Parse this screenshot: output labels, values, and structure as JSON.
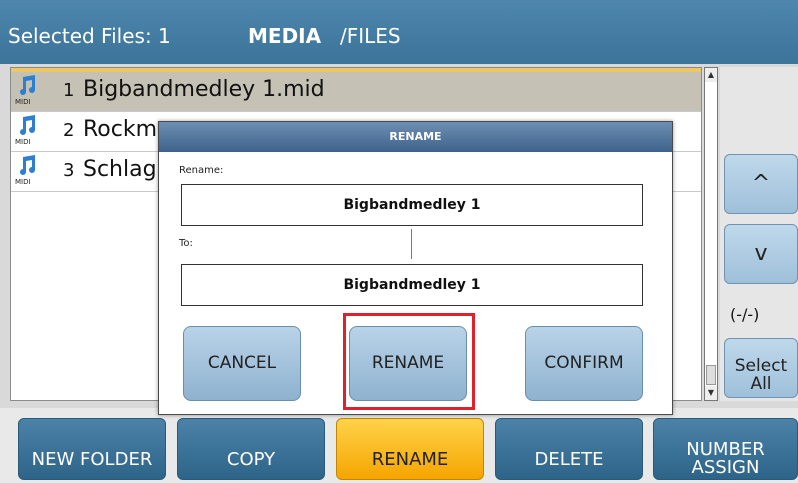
{
  "header": {
    "selected_label": "Selected Files:  1",
    "location": "MEDIA",
    "path": "/FILES"
  },
  "files": [
    {
      "num": "1",
      "name": "Bigbandmedley 1.mid",
      "type": "MIDI"
    },
    {
      "num": "2",
      "name": "Rockm",
      "type": "MIDI"
    },
    {
      "num": "3",
      "name": "Schlag",
      "type": "MIDI"
    }
  ],
  "side": {
    "up": "^",
    "down": "v",
    "page": "(-/-)",
    "select_all_1": "Select",
    "select_all_2": "All"
  },
  "dialog": {
    "title": "RENAME",
    "rename_label": "Rename:",
    "rename_value": "Bigbandmedley 1",
    "to_label": "To:",
    "to_value": "Bigbandmedley 1",
    "cancel": "CANCEL",
    "rename": "RENAME",
    "confirm": "CONFIRM"
  },
  "bottom": {
    "new_folder": "NEW FOLDER",
    "copy": "COPY",
    "rename": "RENAME",
    "delete": "DELETE",
    "number_1": "NUMBER",
    "number_2": "ASSIGN"
  },
  "colors": {
    "header": "#3b7399",
    "active": "#f5a500",
    "highlight": "#e0202a"
  },
  "icons": [
    "music-note-icon",
    "scroll-up-icon",
    "scroll-down-icon"
  ]
}
